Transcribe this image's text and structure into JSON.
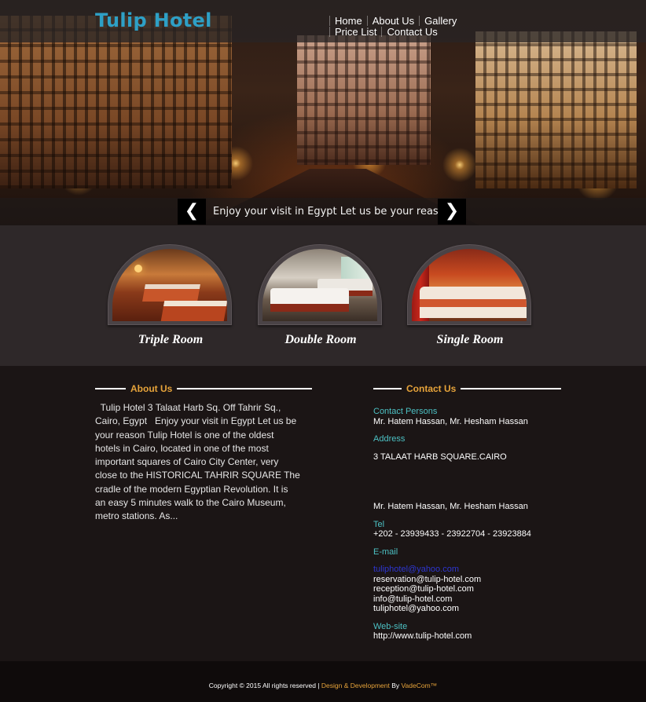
{
  "header": {
    "logo": "Tulip Hotel",
    "nav": [
      "Home",
      "About Us",
      "Gallery",
      "Price List",
      "Contact Us"
    ]
  },
  "slider": {
    "caption": "Enjoy your visit in Egypt Let us be your reason",
    "prev_icon": "chevron-left-icon",
    "next_icon": "chevron-right-icon",
    "prev_glyph": "❮",
    "next_glyph": "❯"
  },
  "rooms": [
    {
      "label": "Triple Room"
    },
    {
      "label": "Double Room"
    },
    {
      "label": "Single Room"
    }
  ],
  "about": {
    "title": "About Us",
    "text": "  Tulip Hotel 3 Talaat Harb Sq. Off Tahrir Sq., Cairo, Egypt   Enjoy your visit in Egypt Let us be your reason Tulip Hotel is one of the oldest hotels in Cairo, located in one of the most important squares of Cairo City Center, very close to the HISTORICAL TAHRIR SQUARE The cradle of the modern Egyptian Revolution. It is an easy 5 minutes walk to the Cairo Museum, metro stations. As..."
  },
  "contact": {
    "title": "Contact Us",
    "persons_label": "Contact Persons",
    "persons": "Mr. Hatem Hassan, Mr. Hesham Hassan",
    "address_label": "Address",
    "address": "3 TALAAT HARB SQUARE.CAIRO",
    "persons_repeat": "Mr. Hatem Hassan, Mr. Hesham Hassan",
    "tel_label": "Tel",
    "tel": "+202 - 23939433 - 23922704 - 23923884",
    "email_label": "E-mail",
    "email_link": "tuliphotel@yahoo.com",
    "emails": [
      "reservation@tulip-hotel.com",
      "reception@tulip-hotel.com",
      "info@tulip-hotel.com",
      "tuliphotel@yahoo.com"
    ],
    "website_label": "Web-site",
    "website": "http://www.tulip-hotel.com"
  },
  "footer": {
    "copyright": "Copyright © 2015 All rights reserved | ",
    "design": "Design & Development",
    "by": " By ",
    "company": "VadeCom™"
  },
  "colors": {
    "logo": "#2ea0c6",
    "accent_orange": "#e6a33a",
    "label_teal": "#4cc1c4"
  }
}
